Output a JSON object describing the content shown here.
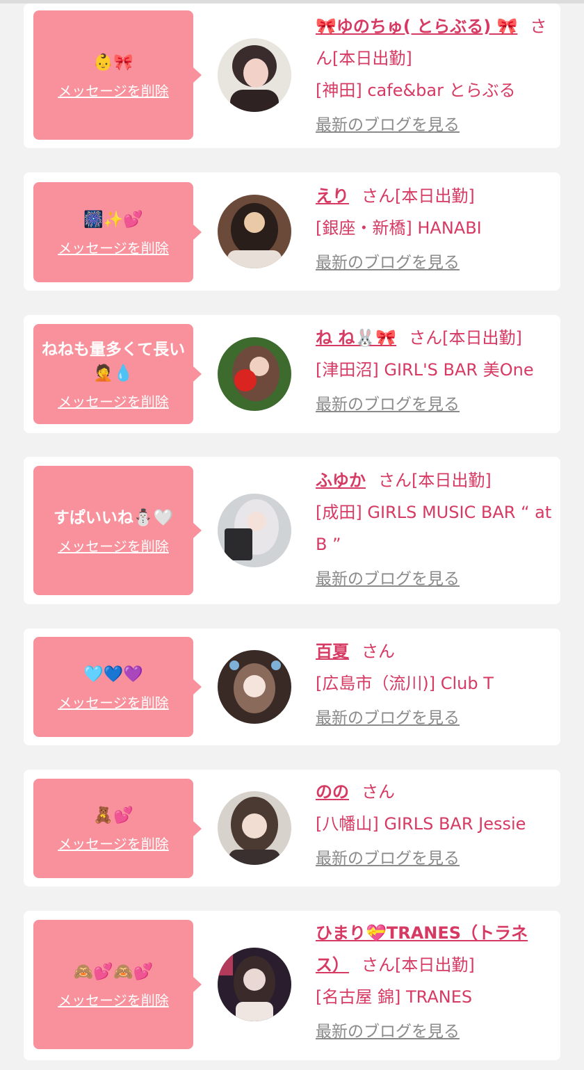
{
  "cards": [
    {
      "message": "👶🎀",
      "delete_label": "メッセージを削除",
      "name": "🎀ゆのちゅ( とらぶる) 🎀",
      "suffix": "さん[本日出勤]",
      "shop": "[神田] cafe&bar とらぶる",
      "blog_label": "最新のブログを見る",
      "avatar_colors": [
        "#e8e4de",
        "#3a2c2c",
        "#f2d2c8"
      ]
    },
    {
      "message": "🎆✨💕",
      "delete_label": "メッセージを削除",
      "name": "えり",
      "suffix": "さん[本日出勤]",
      "shop": "[銀座・新橋] HANABI",
      "blog_label": "最新のブログを見る",
      "avatar_colors": [
        "#6b4a3a",
        "#2a1e1a",
        "#e9c9a6"
      ]
    },
    {
      "message": "ねねも量多くて長い🤦💧",
      "delete_label": "メッセージを削除",
      "name": "ね ね🐰🎀",
      "suffix": "さん[本日出勤]",
      "shop": "[津田沼] GIRL'S BAR 美One",
      "blog_label": "最新のブログを見る",
      "avatar_colors": [
        "#3d6b2e",
        "#6e4a3c",
        "#d9241f"
      ]
    },
    {
      "message": "すぱいいね⛄🤍",
      "delete_label": "メッセージを削除",
      "name": "ふゆか",
      "suffix": "さん[本日出勤]",
      "shop": "[成田] GIRLS MUSIC BAR “ at B ”",
      "blog_label": "最新のブログを見る",
      "avatar_colors": [
        "#cfd3d6",
        "#e8e6e8",
        "#2b2b2e"
      ]
    },
    {
      "message": "🩵💙💜",
      "delete_label": "メッセージを削除",
      "name": "百夏",
      "suffix": "さん",
      "shop": "[広島市（流川)] Club T",
      "blog_label": "最新のブログを見る",
      "avatar_colors": [
        "#3a2a26",
        "#f4e4dc",
        "#7fb0d8"
      ]
    },
    {
      "message": "🧸💕",
      "delete_label": "メッセージを削除",
      "name": "のの",
      "suffix": "さん",
      "shop": "[八幡山] GIRLS BAR Jessie",
      "blog_label": "最新のブログを見る",
      "avatar_colors": [
        "#d8d2cc",
        "#4a3a32",
        "#f2ddd2"
      ]
    },
    {
      "message": "🙈💕🙈💕",
      "delete_label": "メッセージを削除",
      "name": "ひまり💝TRANES（トラネス）",
      "suffix": "さん[本日出勤]",
      "shop": "[名古屋 錦] TRANES",
      "blog_label": "最新のブログを見る",
      "avatar_colors": [
        "#2a1e2e",
        "#e9d8d4",
        "#b23a5a"
      ]
    }
  ]
}
